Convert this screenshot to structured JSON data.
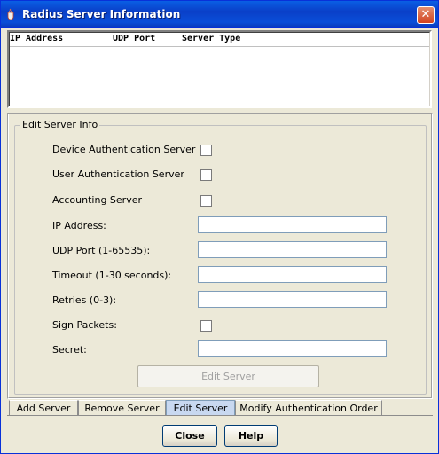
{
  "window": {
    "title": "Radius Server Information",
    "close_glyph": "✕",
    "app_icon": "java-cup-icon",
    "title_bar_color": "#0a4fd9"
  },
  "table": {
    "columns": [
      "IP Address",
      "UDP Port",
      "Server Type"
    ]
  },
  "group": {
    "title": "Edit Server Info"
  },
  "form": {
    "device_auth_label": "Device Authentication Server",
    "user_auth_label": "User Authentication Server",
    "accounting_label": "Accounting Server",
    "ip_label": "IP Address:",
    "udp_label": "UDP Port (1-65535):",
    "timeout_label": "Timeout (1-30 seconds):",
    "retries_label": "Retries (0-3):",
    "sign_label": "Sign Packets:",
    "secret_label": "Secret:",
    "ip_value": "",
    "udp_value": "",
    "timeout_value": "",
    "retries_value": "",
    "secret_value": "",
    "edit_button": "Edit Server"
  },
  "tabs": [
    "Add Server",
    "Remove Server",
    "Edit Server",
    "Modify Authentication Order"
  ],
  "active_tab": "Edit Server",
  "buttons": {
    "close": "Close",
    "help": "Help"
  }
}
